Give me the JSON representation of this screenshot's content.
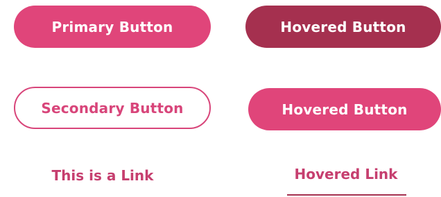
{
  "buttons": {
    "primary_label": "Primary Button",
    "hovered_label": "Hovered Button",
    "secondary_label": "Secondary Button",
    "hovered_raised_label": "Hovered Button"
  },
  "links": {
    "normal_label": "This is a Link",
    "hovered_label": "Hovered Link"
  },
  "colors": {
    "primary": "#e0457a",
    "primary_hover": "#a5304f",
    "link": "#c63f6f",
    "background": "#ffffff"
  }
}
